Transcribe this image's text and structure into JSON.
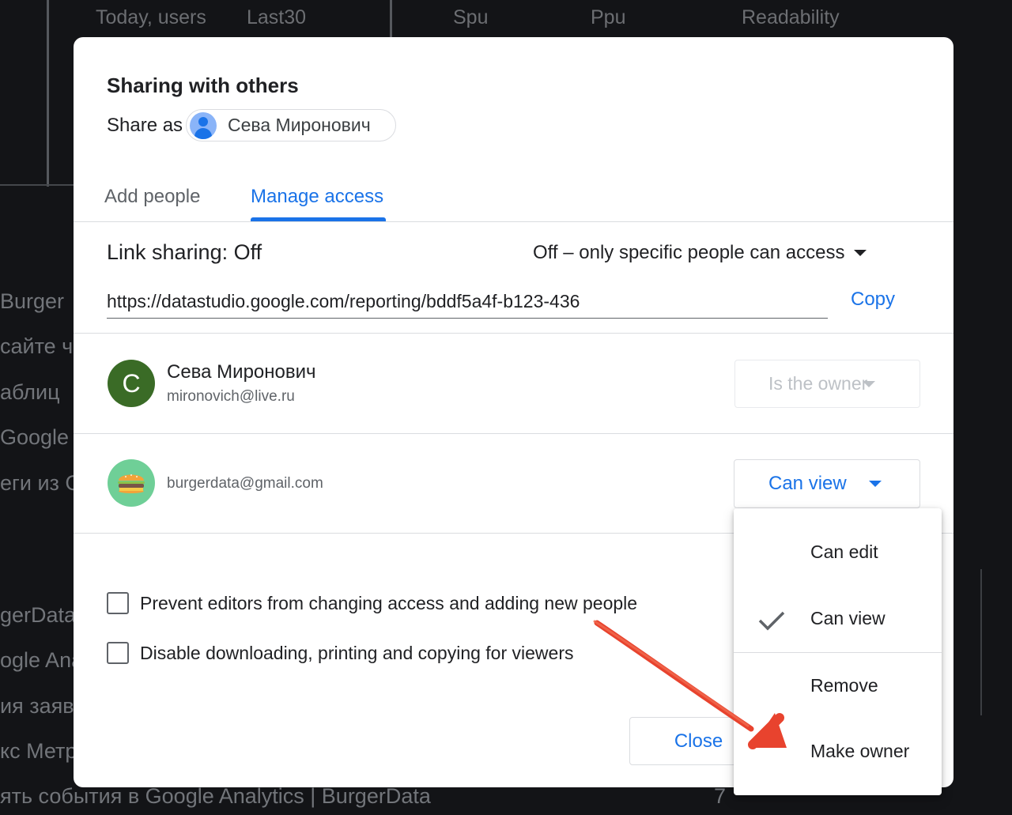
{
  "background": {
    "columns": [
      "Today, users",
      "Last30",
      "Spu",
      "Ppu",
      "Readability"
    ],
    "rows": [
      "Burger",
      "сайте ч",
      "аблиц",
      "Google",
      "еги из G",
      "gerData",
      "ogle Ana",
      "ия заяв",
      "кс Метр",
      "ять события в Google Analytics | BurgerData"
    ],
    "last_row_count": "7"
  },
  "dialog": {
    "title": "Sharing with others",
    "share_as_label": "Share as",
    "share_as_name": "Сева Миронович",
    "tabs": [
      {
        "label": "Add people",
        "active": false
      },
      {
        "label": "Manage access",
        "active": true
      }
    ],
    "link_sharing": {
      "label": "Link sharing: Off",
      "mode": "Off – only specific people can access",
      "url": "https://datastudio.google.com/reporting/bddf5a4f-b123-436",
      "copy_label": "Copy"
    },
    "people": [
      {
        "initial": "C",
        "name": "Сева Миронович",
        "email": "mironovich@live.ru",
        "role": "Is the owner"
      },
      {
        "email": "burgerdata@gmail.com",
        "role": "Can view"
      }
    ],
    "options": [
      {
        "label": "Prevent editors from changing access and adding new people",
        "checked": false
      },
      {
        "label": "Disable downloading, printing and copying for viewers",
        "checked": false
      }
    ],
    "close_label": "Close"
  },
  "role_menu": {
    "items": [
      {
        "label": "Can edit",
        "selected": false
      },
      {
        "label": "Can view",
        "selected": true
      },
      {
        "label": "Remove",
        "selected": false
      },
      {
        "label": "Make owner",
        "selected": false
      }
    ]
  },
  "colors": {
    "accent": "#1a73e8",
    "owner_avatar": "#3a6b26",
    "annotation_arrow": "#e8432e"
  }
}
